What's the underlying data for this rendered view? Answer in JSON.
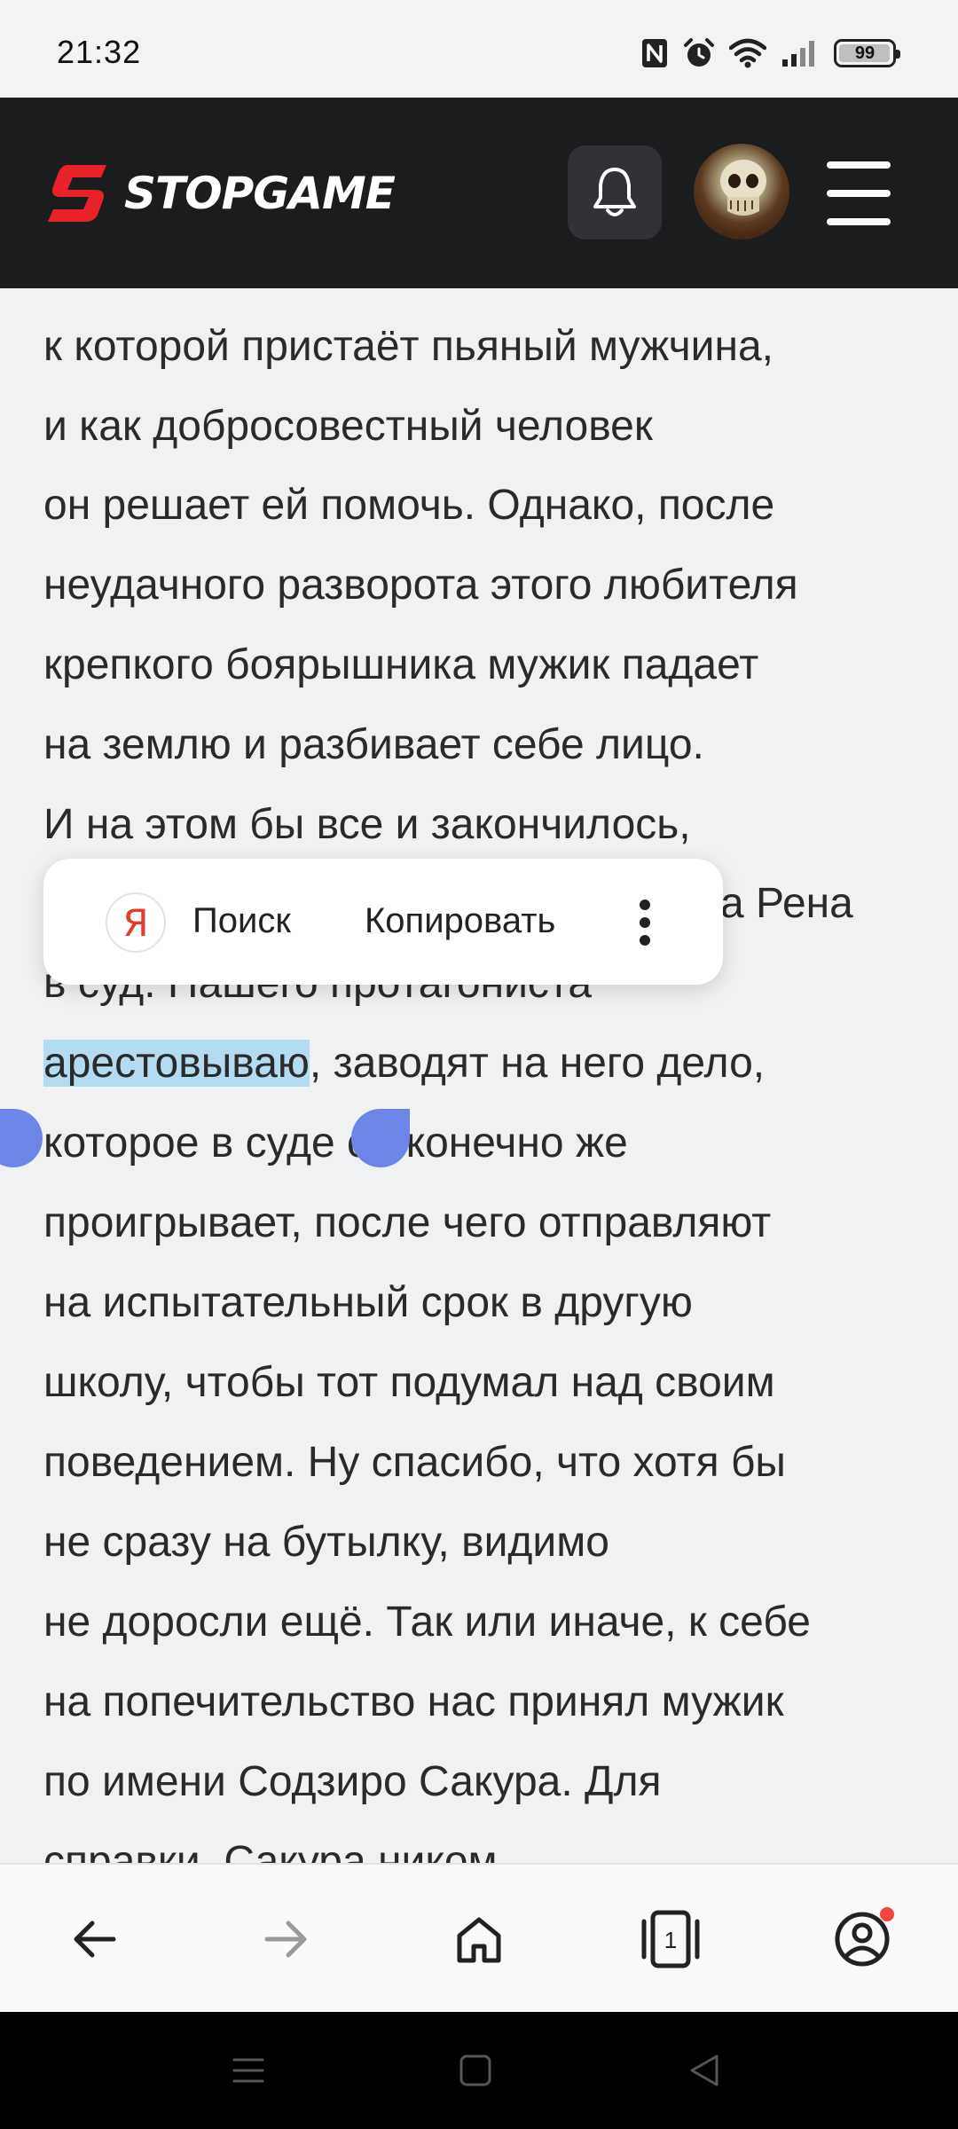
{
  "status_bar": {
    "time": "21:32",
    "battery": "99",
    "battery_percent": 99,
    "icons": [
      "nfc-icon",
      "alarm-icon",
      "wifi-icon",
      "signal-icon",
      "battery-icon"
    ]
  },
  "header": {
    "logo_text": "STOPGAME",
    "brand_color": "#e8212a",
    "background_color": "#1b1c1e",
    "icons": [
      "bell-icon",
      "user-avatar",
      "menu-icon"
    ]
  },
  "article": {
    "text_color": "#2a2a2a",
    "selection_color": "#b3dcf0",
    "lines": [
      "к которой пристаёт пьяный мужчина,",
      "и как добросовестный человек",
      "он решает ей помочь. Однако, после",
      "неудачного разворота этого любителя",
      "крепкого боярышника мужик падает",
      "на землю и разбивает себе лицо.",
      "И на этом бы все и закончилось,",
      "а Рена",
      "в суд. Нашего протагониста",
      "",
      "которое в суде он конечно же",
      "проигрывает, после чего отправляют",
      "на испытательный срок в другую",
      "школу, чтобы тот подумал над своим",
      "поведением. Ну спасибо, что хотя бы",
      "не сразу на бутылку, видимо",
      "не доросли ещё. Так или иначе, к себе",
      "на попечительство нас принял мужик",
      "по имени Содзиро Сакура. Для",
      "справки, Сакура ником"
    ],
    "selected_word": "арестовываю",
    "after_selection": ", заводят на него дело,"
  },
  "context_menu": {
    "yandex_letter": "Я",
    "search_label": "Поиск",
    "copy_label": "Копировать",
    "more_icon": "more-vertical-icon"
  },
  "bottom_nav": {
    "tabs_count": "1",
    "icons": [
      "back-arrow-icon",
      "forward-arrow-icon",
      "home-icon",
      "tabs-icon",
      "profile-icon"
    ],
    "notification_color": "#f0453a"
  },
  "system_nav": {
    "icons": [
      "recents-icon",
      "home-square-icon",
      "back-triangle-icon"
    ]
  }
}
